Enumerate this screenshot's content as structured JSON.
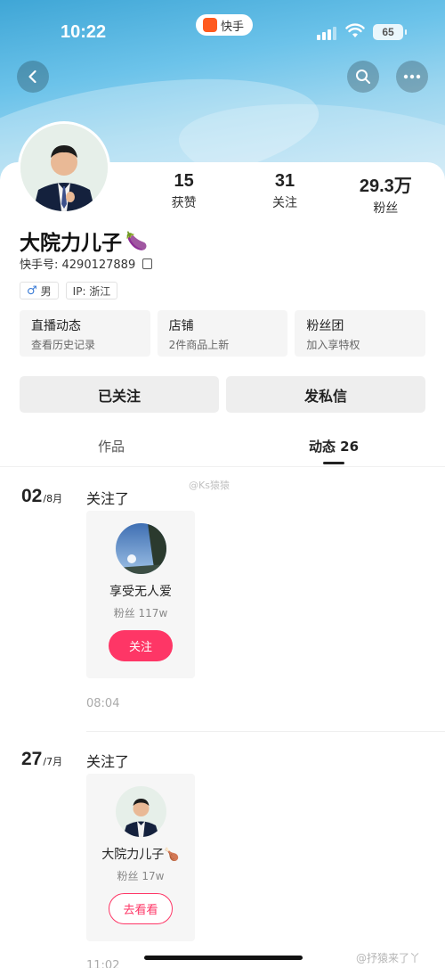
{
  "status_bar": {
    "time": "10:22",
    "app_name": "快手",
    "battery": "65"
  },
  "profile": {
    "stats": [
      {
        "value": "15",
        "label": "获赞"
      },
      {
        "value": "31",
        "label": "关注"
      },
      {
        "value": "29.3万",
        "label": "粉丝"
      }
    ],
    "name": "大院力儿子",
    "name_emoji": "🍆",
    "kuaishou_id": "快手号: 4290127889",
    "tags": [
      {
        "icon": "male-icon",
        "symbol": "♂",
        "text": "男"
      },
      {
        "text": "IP: 浙江"
      }
    ],
    "info_cards": [
      {
        "title": "直播动态",
        "subtitle": "查看历史记录"
      },
      {
        "title": "店铺",
        "subtitle": "2件商品上新"
      },
      {
        "title": "粉丝团",
        "subtitle": "加入享特权"
      }
    ],
    "actions": {
      "followed": "已关注",
      "message": "发私信"
    }
  },
  "tabs": [
    {
      "label": "作品",
      "active": false
    },
    {
      "label": "动态 26",
      "active": true
    }
  ],
  "watermarks": {
    "top": "@Ks猿猿",
    "bottom": "@抒猿来了丫"
  },
  "feed": [
    {
      "day": "02",
      "month": "/8月",
      "action": "关注了",
      "user": {
        "name": "享受无人爱",
        "fans": "粉丝 117w"
      },
      "button": "关注",
      "time": "08:04"
    },
    {
      "day": "27",
      "month": "/7月",
      "action": "关注了",
      "user": {
        "name": "大院力儿子",
        "name_emoji": "🍗",
        "fans": "粉丝 17w"
      },
      "button": "去看看",
      "time": "11:02"
    }
  ],
  "colors": {
    "accent": "#fe3666",
    "header_blue": "#6cc3ea"
  }
}
